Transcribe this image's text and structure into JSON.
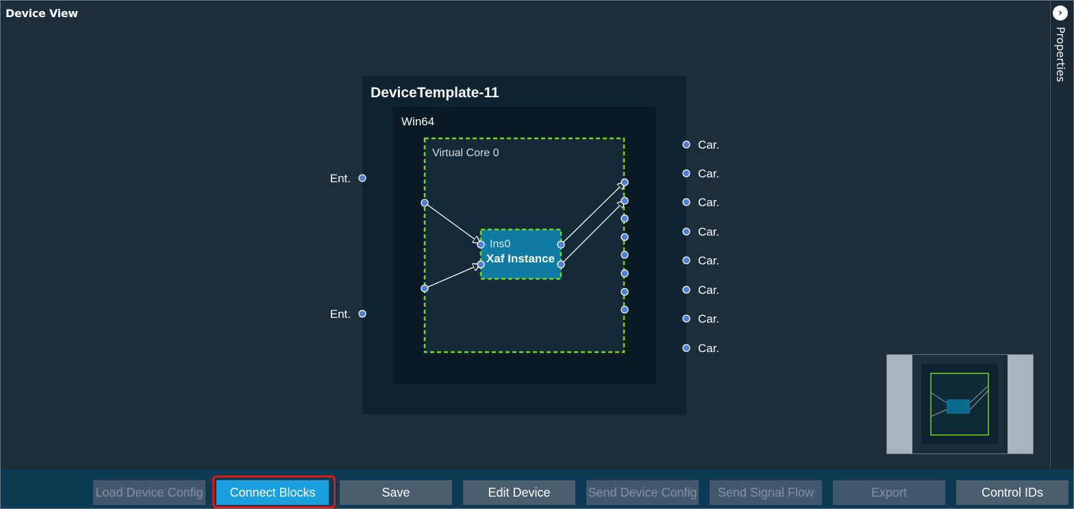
{
  "window": {
    "title": "Device View"
  },
  "properties_panel": {
    "label": "Properties",
    "toggle_icon": "chevron-right-icon"
  },
  "device": {
    "name": "DeviceTemplate-11",
    "platform": "Win64",
    "core": "Virtual Core 0",
    "instance": {
      "id": "Ins0",
      "type": "Xaf Instance"
    },
    "inputs": [
      "Ent.",
      "Ent."
    ],
    "outputs": [
      "Car.",
      "Car.",
      "Car.",
      "Car.",
      "Car.",
      "Car.",
      "Car.",
      "Car."
    ]
  },
  "toolbar": {
    "buttons": [
      {
        "label": "Load Device Config",
        "state": "disabled"
      },
      {
        "label": "Connect Blocks",
        "state": "active"
      },
      {
        "label": "Save",
        "state": "enabled"
      },
      {
        "label": "Edit Device",
        "state": "enabled"
      },
      {
        "label": "Send Device Config",
        "state": "disabled"
      },
      {
        "label": "Send Signal Flow",
        "state": "disabled"
      },
      {
        "label": "Export",
        "state": "disabled"
      },
      {
        "label": "Control IDs",
        "state": "enabled"
      }
    ]
  },
  "colors": {
    "background": "#1e2d3a",
    "device_box": "#0e2230",
    "platform_box": "#0b1a25",
    "core_border": "#7ad61c",
    "instance_fill": "#0d7ba3",
    "port": "#4d7fd6",
    "active_button": "#1aa0e0",
    "focus_ring": "#e01818"
  }
}
